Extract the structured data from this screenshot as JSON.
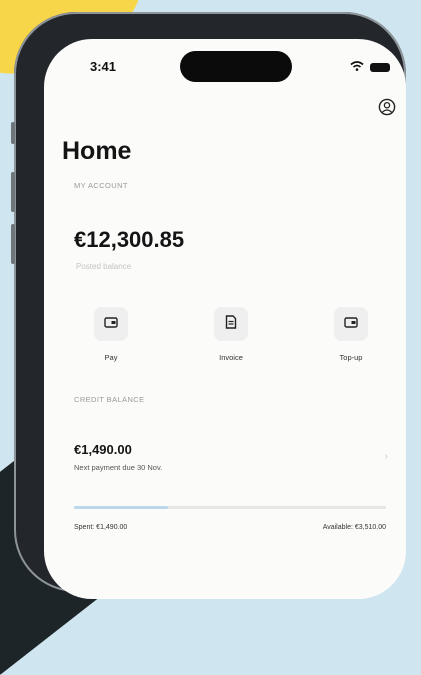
{
  "status_bar": {
    "time": "3:41"
  },
  "icons": {
    "profile": "user-circle-icon",
    "pay": "wallet-icon",
    "invoice": "document-icon",
    "topup": "wallet-icon",
    "wifi": "wifi-icon",
    "battery": "battery-icon"
  },
  "home": {
    "title": "Home",
    "account_label": "MY ACCOUNT",
    "balance": "€12,300.85",
    "balance_sub": "Posted balance"
  },
  "actions": [
    {
      "label": "Pay"
    },
    {
      "label": "Invoice"
    },
    {
      "label": "Top-up"
    }
  ],
  "credit": {
    "label": "CREDIT BALANCE",
    "amount": "€1,490.00",
    "next_payment": "Next payment due 30 Nov.",
    "spent": "Spent: €1,490.00",
    "available": "Available: €3,510.00",
    "spent_fraction": 0.3
  },
  "colors": {
    "background": "#cfe6f0",
    "accent_yellow": "#f7d64a",
    "progress_fill": "#bcd7ec"
  }
}
